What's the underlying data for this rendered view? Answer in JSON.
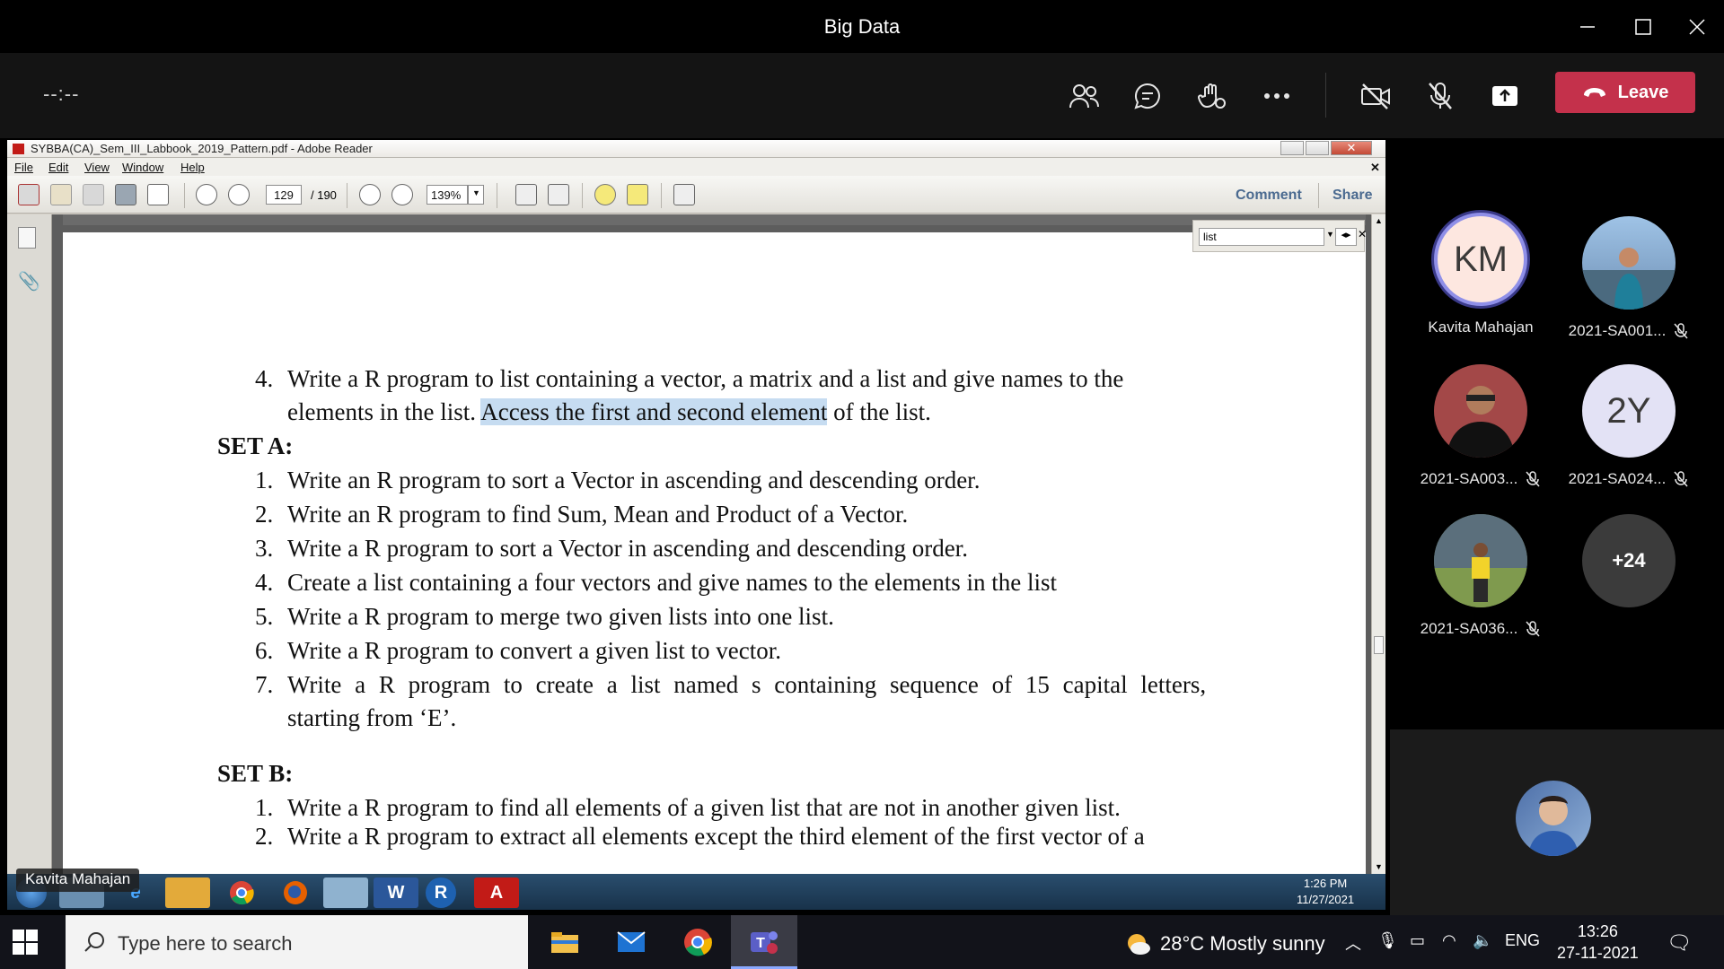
{
  "window": {
    "title": "Big Data"
  },
  "meeting": {
    "timer": "--:--",
    "leave_label": "Leave",
    "participants": [
      {
        "initials": "KM",
        "name": "Kavita Mahajan",
        "muted": false
      },
      {
        "initials": "",
        "name": "2021-SA001...",
        "muted": true
      },
      {
        "initials": "",
        "name": "2021-SA003...",
        "muted": true
      },
      {
        "initials": "2Y",
        "name": "2021-SA024...",
        "muted": true
      },
      {
        "initials": "",
        "name": "2021-SA036...",
        "muted": true
      },
      {
        "initials": "+24",
        "name": "",
        "muted": false
      }
    ],
    "presenter_chip": "Kavita Mahajan"
  },
  "reader": {
    "title": "SYBBA(CA)_Sem_III_Labbook_2019_Pattern.pdf - Adobe Reader",
    "menu": [
      "File",
      "Edit",
      "View",
      "Window",
      "Help"
    ],
    "page_current": "129",
    "page_total": "/ 190",
    "zoom": "139%",
    "comment_label": "Comment",
    "share_label": "Share",
    "find_text": "list"
  },
  "document": {
    "item4_num": "4.",
    "item4_line1": "Write a R program to list containing a vector, a matrix and a list and give names to the",
    "item4_line2_pre": "elements in the list. ",
    "item4_line2_hl": "Access the first and second element",
    "item4_line2_post": " of the list.",
    "set_a": "SET A:",
    "set_a_items": [
      {
        "num": "1.",
        "text": "Write an R program to sort a Vector in ascending and descending order."
      },
      {
        "num": "2.",
        "text": "Write an R program to find Sum, Mean and Product of a Vector."
      },
      {
        "num": "3.",
        "text": "Write a R program to sort a Vector in ascending and descending order."
      },
      {
        "num": "4.",
        "text": "Create a list containing a four vectors and give names to the elements in the list"
      },
      {
        "num": "5.",
        "text": "Write a R program to merge two given lists into one list."
      },
      {
        "num": "6.",
        "text": "Write a R program to convert a given list to vector."
      },
      {
        "num": "7.",
        "text": "Write a R program to create a list named s containing sequence of 15 capital letters,"
      }
    ],
    "set_a_item7_cont": "starting from ‘E’.",
    "set_b": "SET B:",
    "set_b_items": [
      {
        "num": "1.",
        "text": "Write a R program to find all elements of a given list that are not in another given list."
      },
      {
        "num": "2.",
        "text": "Write a R program to extract all elements except the third element of the first vector of a"
      }
    ]
  },
  "remote_taskbar": {
    "time": "1:26 PM",
    "date": "11/27/2021"
  },
  "taskbar": {
    "search_placeholder": "Type here to search",
    "weather": "28°C  Mostly sunny",
    "language": "ENG",
    "time": "13:26",
    "date": "27-11-2021"
  }
}
